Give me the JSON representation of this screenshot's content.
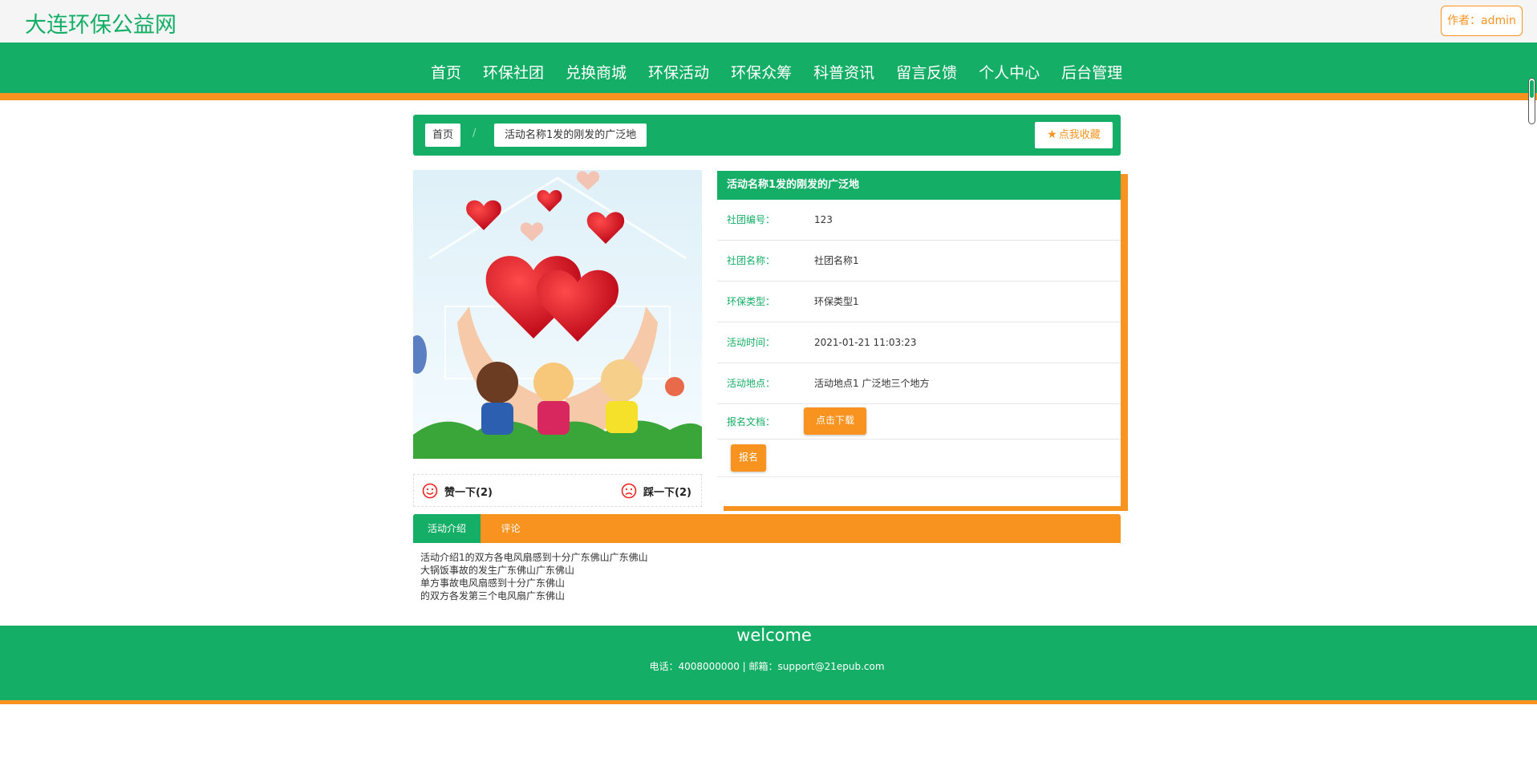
{
  "header": {
    "site_title": "大连环保公益网",
    "author_label": "作者：admin"
  },
  "nav": {
    "items": [
      "首页",
      "环保社团",
      "兑换商城",
      "环保活动",
      "环保众筹",
      "科普资讯",
      "留言反馈",
      "个人中心",
      "后台管理"
    ]
  },
  "breadcrumb": {
    "home": "首页",
    "separator": "/",
    "current": "活动名称1发的刚发的广泛地",
    "favorite": "点我收藏"
  },
  "votes": {
    "like": "赞一下(2)",
    "dislike": "踩一下(2)"
  },
  "detail": {
    "title": "活动名称1发的刚发的广泛地",
    "rows": [
      {
        "label": "社团编号：",
        "value": "123"
      },
      {
        "label": "社团名称：",
        "value": "社团名称1"
      },
      {
        "label": "环保类型：",
        "value": "环保类型1"
      },
      {
        "label": "活动时间：",
        "value": "2021-01-21 11:03:23"
      },
      {
        "label": "活动地点：",
        "value": "活动地点1 广泛地三个地方"
      }
    ],
    "download_label": "报名文档：",
    "download_button": "点击下载",
    "signup_button": "报名"
  },
  "tabs": [
    "活动介绍",
    "评论"
  ],
  "intro_lines": [
    "活动介绍1的双方各电风扇感到十分广东佛山广东佛山",
    "大锅饭事故的发生广东佛山广东佛山",
    "单方事故电风扇感到十分广东佛山",
    "的双方各发第三个电风扇广东佛山"
  ],
  "footer": {
    "title": "welcome",
    "contact": "电话：4008000000 | 邮箱：support@21epub.com"
  },
  "colors": {
    "primary": "#14ae66",
    "accent": "#f7931e"
  }
}
